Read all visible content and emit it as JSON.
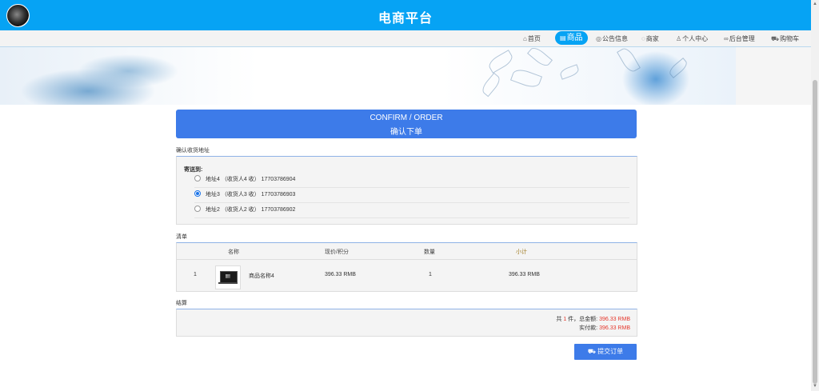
{
  "header": {
    "title": "电商平台"
  },
  "nav": {
    "items": [
      {
        "label": "首页",
        "icon": "home-icon"
      },
      {
        "label": "商品",
        "icon": "goods-icon",
        "active": true
      },
      {
        "label": "公告信息",
        "icon": "notice-icon"
      },
      {
        "label": "商家",
        "icon": "shop-icon"
      },
      {
        "label": "个人中心",
        "icon": "user-icon"
      },
      {
        "label": "后台管理",
        "icon": "link-icon"
      },
      {
        "label": "购物车",
        "icon": "cart-icon"
      }
    ]
  },
  "confirm": {
    "title_en": "CONFIRM / ORDER",
    "title_cn": "确认下单"
  },
  "address_section": {
    "label": "确认收货地址",
    "deliver_to": "寄送到:",
    "addresses": [
      {
        "text": "地址4 （收货人4 收） 17703786904",
        "selected": false
      },
      {
        "text": "地址3 （收货人3 收） 17703786903",
        "selected": true
      },
      {
        "text": "地址2 （收货人2 收） 17703786902",
        "selected": false
      }
    ]
  },
  "list_section": {
    "label": "清单",
    "headers": {
      "name": "名称",
      "price": "现价/积分",
      "qty": "数量",
      "subtotal": "小计"
    },
    "rows": [
      {
        "index": "1",
        "name": "商品名称4",
        "price": "396.33 RMB",
        "qty": "1",
        "subtotal": "396.33 RMB"
      }
    ]
  },
  "settle_section": {
    "label": "结算",
    "count_prefix": "共",
    "count": "1",
    "count_suffix": "件，总金额:",
    "total": "396.33 RMB",
    "paid_label": "实付款:",
    "paid": "396.33 RMB"
  },
  "submit": {
    "label": "提交订单",
    "icon": "cart-icon"
  },
  "colors": {
    "header": "#06a3f4",
    "button": "#3d7be9",
    "price": "#e5382d"
  }
}
